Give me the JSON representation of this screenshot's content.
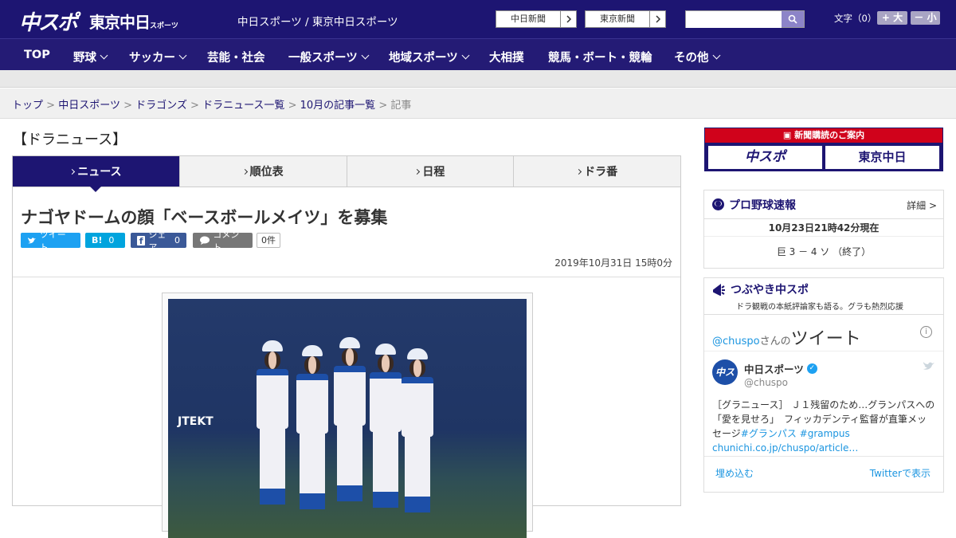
{
  "header": {
    "logo_chuspo": "中スポ",
    "logo_tokyo": "東京中日",
    "logo_tokyo_small": "スポーツ",
    "site_names": "中日スポーツ / 東京中日スポーツ",
    "paper_links": [
      {
        "label": "中日新聞"
      },
      {
        "label": "東京新聞"
      }
    ],
    "search": {
      "placeholder": ""
    },
    "font_size": {
      "label": "文字（0）",
      "bigger": "+ 大",
      "smaller": "－ 小"
    }
  },
  "nav": {
    "items": [
      {
        "label": "TOP",
        "dropdown": false
      },
      {
        "label": "野球",
        "dropdown": true
      },
      {
        "label": "サッカー",
        "dropdown": true
      },
      {
        "label": "芸能・社会",
        "dropdown": false
      },
      {
        "label": "一般スポーツ",
        "dropdown": true
      },
      {
        "label": "地域スポーツ",
        "dropdown": true
      },
      {
        "label": "大相撲",
        "dropdown": false
      },
      {
        "label": "競馬・ボート・競輪",
        "dropdown": false
      },
      {
        "label": "その他",
        "dropdown": true
      }
    ]
  },
  "breadcrumb": {
    "items": [
      "トップ",
      "中日スポーツ",
      "ドラゴンズ",
      "ドラニュース一覧",
      "10月の記事一覧"
    ],
    "current": "記事",
    "separator": ">"
  },
  "section": {
    "title": "【ドラニュース】",
    "tabs": [
      {
        "label": "ニュース",
        "active": true
      },
      {
        "label": "順位表",
        "active": false
      },
      {
        "label": "日程",
        "active": false
      },
      {
        "label": "ドラ番",
        "active": false
      }
    ]
  },
  "article": {
    "headline": "ナゴヤドームの顔「ベースボールメイツ」を募集",
    "share": {
      "tweet": "ツイート",
      "hatena": "B!",
      "hatena_count": "0",
      "facebook": "シェア",
      "facebook_count": "0",
      "comment": "コメント",
      "comment_count": "0件"
    },
    "date": "2019年10月31日 15時0分",
    "photo_sign": "JTEKT"
  },
  "sidebar": {
    "ad": {
      "header": "新聞購読のご案内",
      "logo1": "中スポ",
      "logo2": "東京中日"
    },
    "baseball": {
      "title": "プロ野球速報",
      "detail": "詳細 >",
      "updated": "10月23日21時42分現在",
      "score": "巨 3 － 4 ソ （終了）"
    },
    "tweets": {
      "title": "つぶやき中スポ",
      "subtitle": "ドラ観戦の本紙評論家も語る。グラも熱烈応援",
      "handle_line": "@chuspo",
      "handle_suffix": "さんの",
      "heading": "ツイート",
      "author_name": "中日スポーツ",
      "author_handle": "@chuspo",
      "tweet_text": "［グラニュース］ Ｊ１残留のため…グランパスへの「愛を見せろ」　フィッカデンティ監督が直筆メッセージ",
      "hashtag1": "#グランパス",
      "hashtag2": "#grampus",
      "link": "chunichi.co.jp/chuspo/article…",
      "embed": "埋め込む",
      "view_on_twitter": "Twitterで表示"
    }
  },
  "colors": {
    "brand": "#1d1572",
    "accent_red": "#d0021b",
    "twitter_blue": "#1da1f2",
    "hatena": "#00a4de",
    "facebook": "#3b5998"
  }
}
